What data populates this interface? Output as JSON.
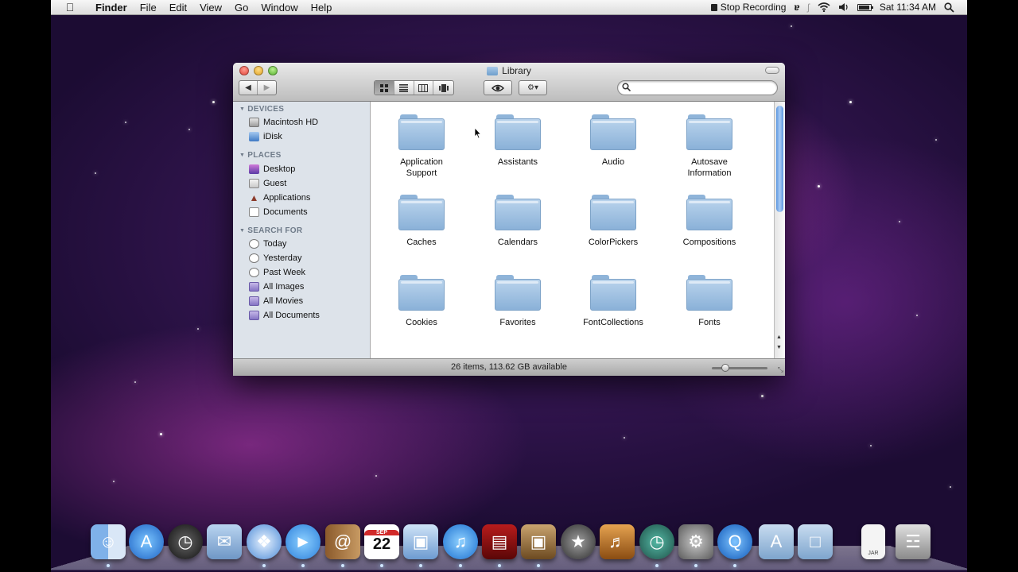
{
  "menubar": {
    "app_name": "Finder",
    "menus": [
      "File",
      "Edit",
      "View",
      "Go",
      "Window",
      "Help"
    ],
    "stop_recording": "Stop Recording",
    "clock": "Sat 11:34 AM",
    "battery_fraction": 0.9
  },
  "window": {
    "title": "Library",
    "search_placeholder": "",
    "status": "26 items, 113.62 GB available",
    "icon_size_fraction": 0.2,
    "scroll_fraction": 0.0
  },
  "sidebar": {
    "devices_header": "DEVICES",
    "devices": [
      "Macintosh HD",
      "iDisk"
    ],
    "places_header": "PLACES",
    "places": [
      "Desktop",
      "Guest",
      "Applications",
      "Documents"
    ],
    "search_header": "SEARCH FOR",
    "searches": [
      "Today",
      "Yesterday",
      "Past Week",
      "All Images",
      "All Movies",
      "All Documents"
    ]
  },
  "folders": [
    "Application Support",
    "Assistants",
    "Audio",
    "Autosave Information",
    "Caches",
    "Calendars",
    "ColorPickers",
    "Compositions",
    "Cookies",
    "Favorites",
    "FontCollections",
    "Fonts"
  ],
  "folder_lines": [
    [
      "Application",
      "Support"
    ],
    [
      "Assistants"
    ],
    [
      "Audio"
    ],
    [
      "Autosave",
      "Information"
    ],
    [
      "Caches"
    ],
    [
      "Calendars"
    ],
    [
      "ColorPickers"
    ],
    [
      "Compositions"
    ],
    [
      "Cookies"
    ],
    [
      "Favorites"
    ],
    [
      "FontCollections"
    ],
    [
      "Fonts"
    ]
  ],
  "dock": {
    "calendar_month": "SEP",
    "calendar_day": "22",
    "jar_label": "JAR",
    "icons": [
      "finder-icon",
      "app-store-icon",
      "dashboard-icon",
      "mail-icon",
      "safari-icon",
      "ichat-icon",
      "address-book-icon",
      "ical-icon",
      "preview-icon",
      "itunes-icon",
      "front-row-icon",
      "iphoto-icon",
      "imovie-icon",
      "garageband-icon",
      "time-machine-icon",
      "system-preferences-icon",
      "quicktime-icon",
      "applications-stack-icon",
      "documents-stack-icon",
      "jar-file-icon",
      "trash-icon"
    ]
  },
  "colors": {
    "menubar_bg": "#e8e8e8",
    "sidebar_bg": "#dde3ea",
    "sidebar_header": "#6f7b89",
    "folder_blue": "#9dc0e3",
    "scroll_thumb": "#5d97e0",
    "wallpaper_purple": "#b03ab0"
  }
}
